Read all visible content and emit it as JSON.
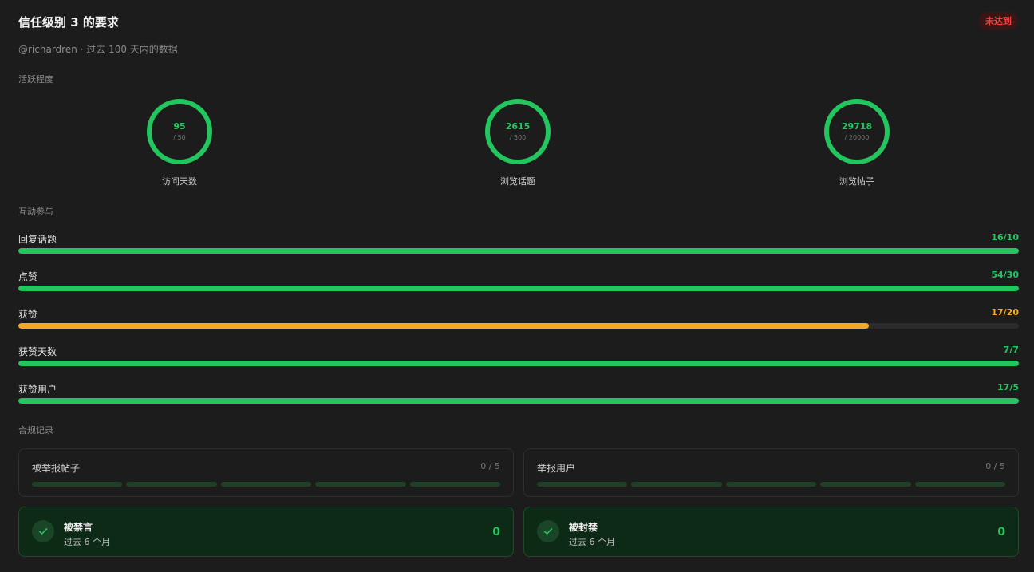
{
  "header": {
    "title": "信任级别 3 的要求",
    "status_badge": "未达到",
    "subtitle": "@richardren · 过去 100 天内的数据"
  },
  "activity": {
    "label": "活跃程度",
    "rings": [
      {
        "value": "95",
        "target": "/ 50",
        "label": "访问天数",
        "fraction": 1.0
      },
      {
        "value": "2615",
        "target": "/ 500",
        "label": "浏览话题",
        "fraction": 1.0
      },
      {
        "value": "29718",
        "target": "/ 20000",
        "label": "浏览帖子",
        "fraction": 1.0
      }
    ]
  },
  "interaction": {
    "label": "互动参与",
    "bars": [
      {
        "label": "回复话题",
        "value": "16/10",
        "fraction": 1.0,
        "color": "#22c55e"
      },
      {
        "label": "点赞",
        "value": "54/30",
        "fraction": 1.0,
        "color": "#22c55e"
      },
      {
        "label": "获赞",
        "value": "17/20",
        "fraction": 0.85,
        "color": "#f5a623"
      },
      {
        "label": "获赞天数",
        "value": "7/7",
        "fraction": 1.0,
        "color": "#22c55e"
      },
      {
        "label": "获赞用户",
        "value": "17/5",
        "fraction": 1.0,
        "color": "#22c55e"
      }
    ]
  },
  "compliance": {
    "label": "合规记录",
    "reports": [
      {
        "title": "被举报帖子",
        "count": "0 / 5"
      },
      {
        "title": "举报用户",
        "count": "0 / 5"
      }
    ],
    "status": [
      {
        "title": "被禁言",
        "sub": "过去 6 个月",
        "value": "0"
      },
      {
        "title": "被封禁",
        "sub": "过去 6 个月",
        "value": "0"
      }
    ]
  },
  "colors": {
    "success": "#22c55e",
    "warning": "#f5a623",
    "danger": "#ef4444"
  }
}
